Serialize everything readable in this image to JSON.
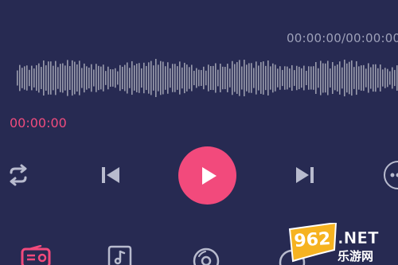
{
  "player": {
    "total_time_label": "00:00:00/00:00:00",
    "current_time": "00:00:00"
  },
  "colors": {
    "background": "#272a52",
    "accent": "#f24a7c",
    "waveform": "#9a9cad",
    "icon": "#b8bbce"
  },
  "icons": {
    "repeat": "repeat-icon",
    "previous": "skip-previous-icon",
    "play": "play-icon",
    "next": "skip-next-icon",
    "more": "more-icon",
    "tabs": [
      "radio-icon",
      "music-file-icon",
      "disc-icon",
      "tab-icon"
    ]
  },
  "watermark": {
    "brand": "962.NET",
    "subtitle": "乐游网"
  }
}
